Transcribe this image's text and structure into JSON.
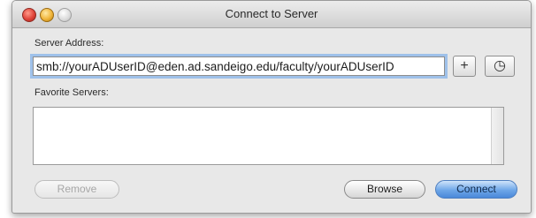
{
  "window": {
    "title": "Connect to Server"
  },
  "server_address": {
    "label": "Server Address:",
    "value": "smb://yourADUserID@eden.ad.sandeigo.edu/faculty/yourADUserID"
  },
  "favorites": {
    "label": "Favorite Servers:",
    "items": []
  },
  "buttons": {
    "add": "+",
    "recent": "◷",
    "remove": "Remove",
    "browse": "Browse",
    "connect": "Connect"
  },
  "colors": {
    "focus_ring": "#9fc1ea",
    "default_button": "#6ea6e8"
  }
}
